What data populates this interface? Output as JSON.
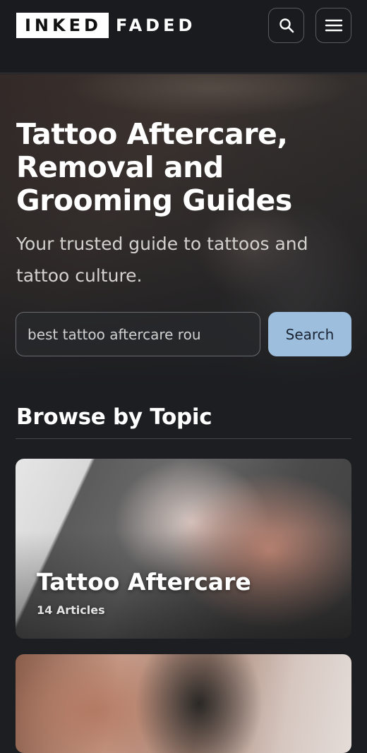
{
  "header": {
    "logo_part1": "INKED",
    "logo_part2": "FADED",
    "search_icon": "search-icon",
    "menu_icon": "menu-icon"
  },
  "hero": {
    "title": "Tattoo Aftercare, Removal and Grooming Guides",
    "subtitle": "Your trusted guide to tattoos and tattoo culture.",
    "search_value": "best tattoo aftercare rou",
    "search_button": "Search"
  },
  "browse": {
    "title": "Browse by Topic",
    "cards": [
      {
        "title": "Tattoo Aftercare",
        "count": "14 Articles"
      }
    ]
  },
  "colors": {
    "background": "#1d1e21",
    "accent": "#9dbedd"
  }
}
